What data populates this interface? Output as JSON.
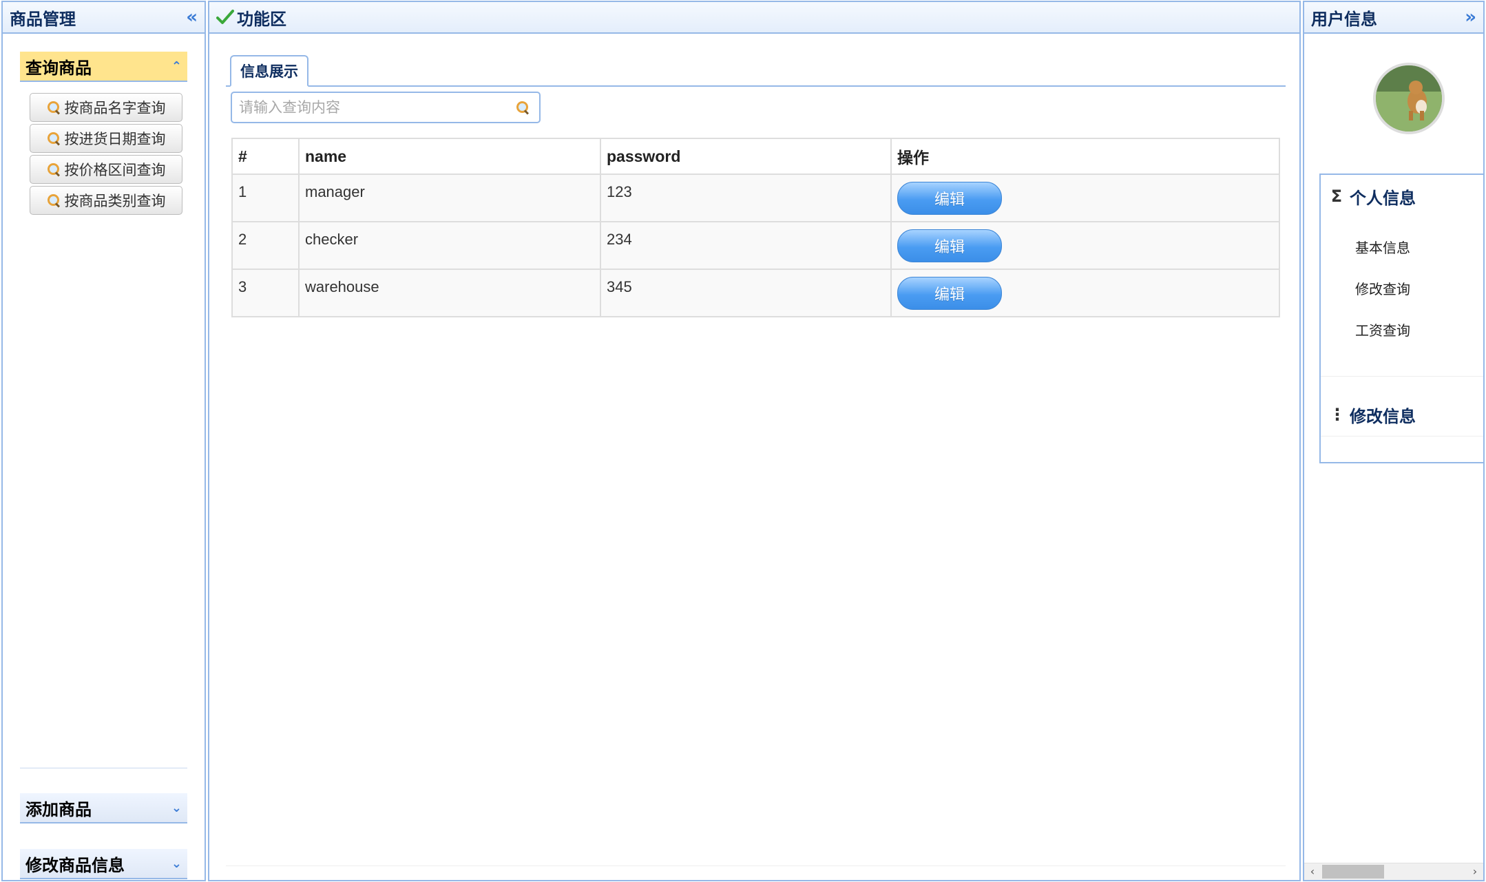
{
  "left_panel": {
    "title": "商品管理",
    "collapse_icon": "«",
    "sections": [
      {
        "title": "查询商品",
        "state": "expanded",
        "tool_icon": "⌃"
      },
      {
        "title": "添加商品",
        "state": "collapsed",
        "tool_icon": "⌄"
      },
      {
        "title": "修改商品信息",
        "state": "collapsed",
        "tool_icon": "⌄"
      }
    ],
    "query_buttons": [
      "按商品名字查询",
      "按进货日期查询",
      "按价格区间查询",
      "按商品类别查询"
    ]
  },
  "center_panel": {
    "title": "功能区",
    "tab": "信息展示",
    "search_placeholder": "请输入查询内容",
    "table": {
      "headers": [
        "#",
        "name",
        "password",
        "操作"
      ],
      "rows": [
        {
          "id": "1",
          "name": "manager",
          "password": "123",
          "action": "编辑"
        },
        {
          "id": "2",
          "name": "checker",
          "password": "234",
          "action": "编辑"
        },
        {
          "id": "3",
          "name": "warehouse",
          "password": "345",
          "action": "编辑"
        }
      ]
    }
  },
  "right_panel": {
    "title": "用户信息",
    "collapse_icon": "»",
    "personal_section": {
      "symbol": "Σ",
      "title": "个人信息",
      "items": [
        "基本信息",
        "修改查询",
        "工资查询"
      ]
    },
    "modify_section": {
      "symbol": "⋮",
      "title": "修改信息"
    }
  },
  "colors": {
    "border": "#95b8e7",
    "active_header": "#ffe48d",
    "button_blue": "#4a9cf2"
  }
}
